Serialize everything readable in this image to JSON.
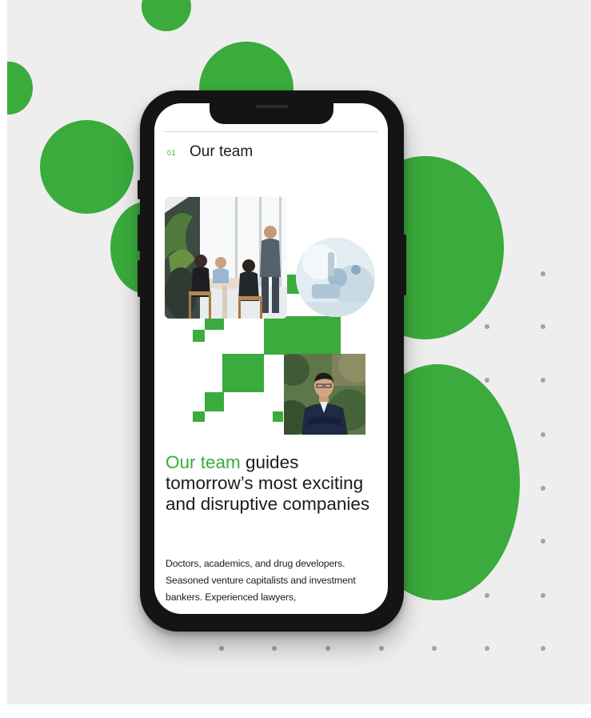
{
  "section": {
    "number": "01",
    "title": "Our team"
  },
  "headline": {
    "accent": "Our team",
    "rest": " guides tomorrow’s most exciting and disruptive companies"
  },
  "body": {
    "text": "Doctors, academics, and drug developers. Seasoned venture capitalists and investment bankers. Experienced lawyers,"
  },
  "images": {
    "team_meeting": "team-meeting-photo",
    "laboratory": "laboratory-photo",
    "team_member": "team-member-portrait"
  },
  "colors": {
    "brand_green": "#3aab3c",
    "background": "#eeeeee",
    "text": "#1c1c1c",
    "dot": "#a3a3a3",
    "phone_frame": "#141414"
  }
}
